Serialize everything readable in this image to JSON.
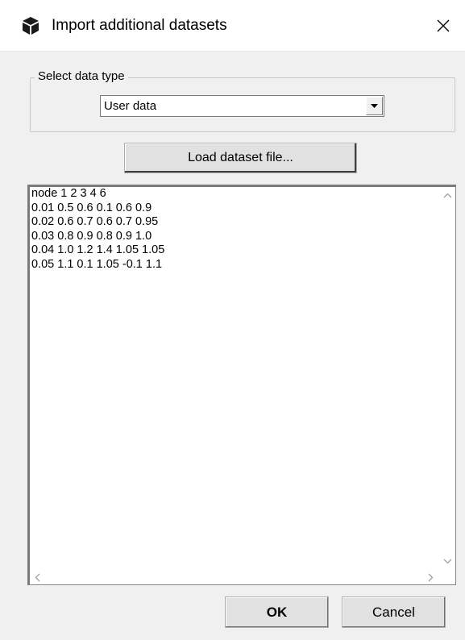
{
  "window": {
    "title": "Import additional datasets",
    "icon": "cube-icon",
    "close_label": "✕"
  },
  "group": {
    "label": "Select data type",
    "select": {
      "selected_value": "User data"
    }
  },
  "load_button": {
    "label": "Load dataset file..."
  },
  "dataset_text": {
    "lines": [
      "node 1 2 3 4 6",
      "0.01 0.5 0.6 0.1 0.6 0.9",
      "0.02 0.6 0.7 0.6 0.7 0.95",
      "0.03 0.8 0.9 0.8 0.9 1.0",
      "0.04 1.0 1.2 1.4 1.05 1.05",
      "0.05 1.1 0.1 1.05 -0.1 1.1"
    ]
  },
  "buttons": {
    "ok_label": "OK",
    "cancel_label": "Cancel"
  }
}
